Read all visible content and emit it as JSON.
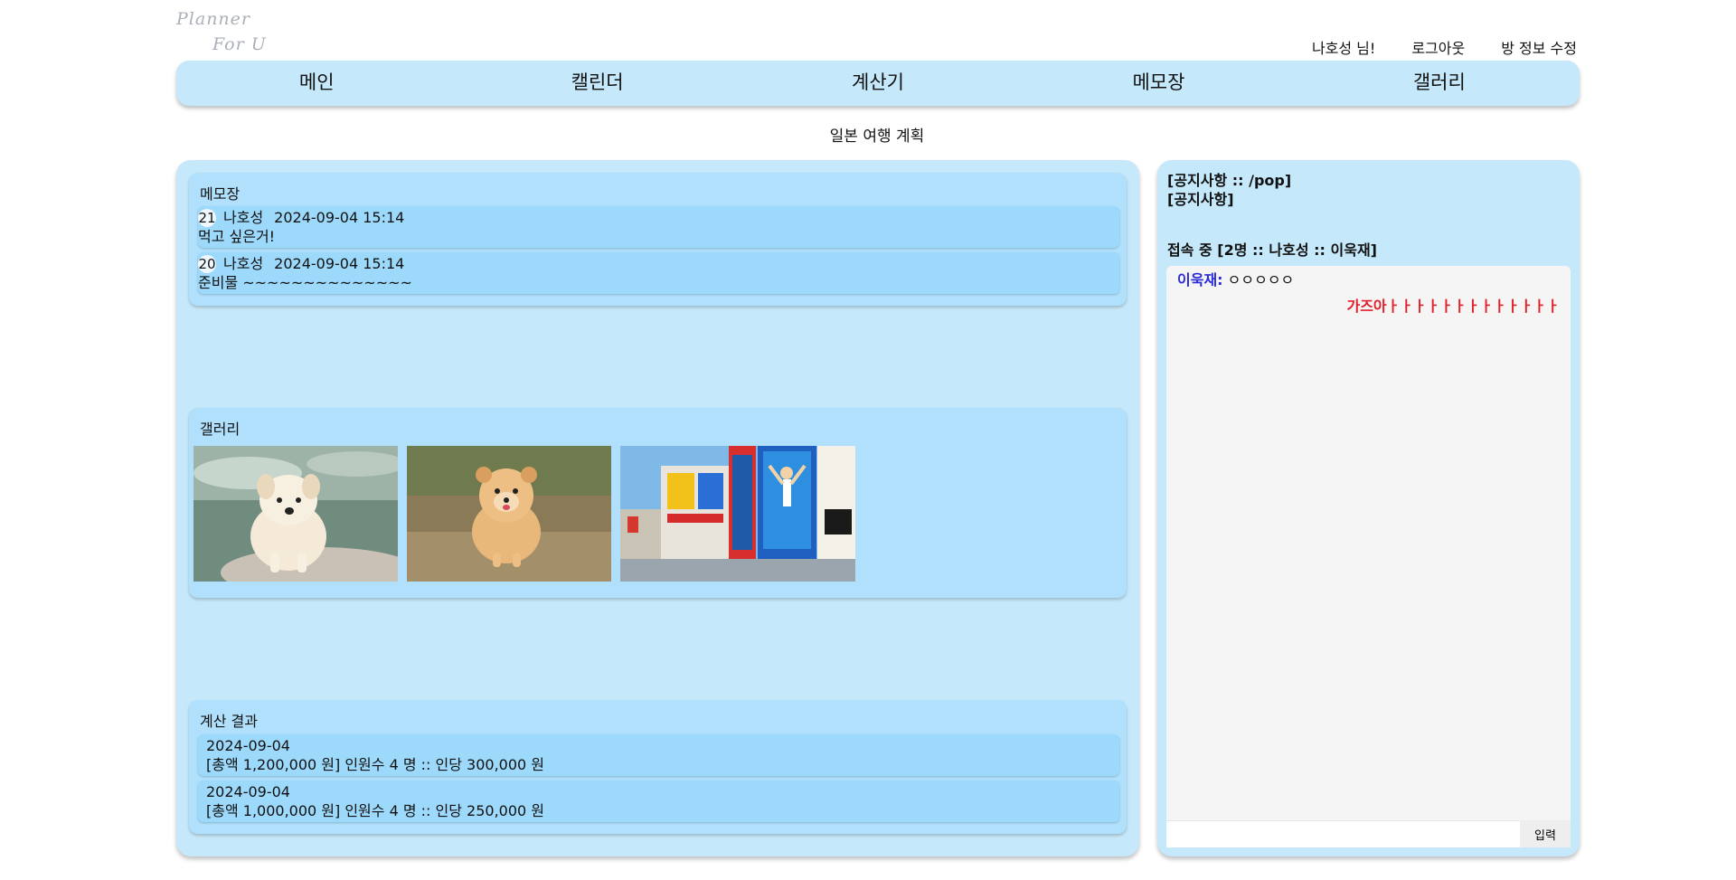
{
  "logo": {
    "line1": "Planner",
    "line2": "For U"
  },
  "topbar": {
    "user": "나호성 님!",
    "logout": "로그아웃",
    "edit_room": "방 정보 수정"
  },
  "nav": [
    "메인",
    "캘린더",
    "계산기",
    "메모장",
    "갤러리"
  ],
  "room_title": "일본 여행 계획",
  "memo": {
    "title": "메모장",
    "items": [
      {
        "id": "21",
        "author": "나호성",
        "datetime": "2024-09-04 15:14",
        "content": "먹고 싶은거!"
      },
      {
        "id": "20",
        "author": "나호성",
        "datetime": "2024-09-04 15:14",
        "content": "준비물 ~~~~~~~~~~~~~~"
      }
    ]
  },
  "gallery": {
    "title": "갤러리",
    "images": [
      "white-puppy-photo",
      "pomeranian-photo",
      "osaka-dotonbori-photo"
    ]
  },
  "calc": {
    "title": "계산 결과",
    "items": [
      {
        "date": "2024-09-04",
        "summary": "[총액 1,200,000 원] 인원수 4 명 :: 인당 300,000 원"
      },
      {
        "date": "2024-09-04",
        "summary": "[총액 1,000,000 원] 인원수 4 명 :: 인당 250,000 원"
      }
    ]
  },
  "sidebar": {
    "notice_title": "[공지사항 :: /pop]",
    "notice_body": "[공지사항]",
    "online": "접속 중 [2명 :: 나호성 :: 이욱재]"
  },
  "chat": {
    "messages": [
      {
        "who": "이욱재:",
        "text": "ㅇㅇㅇㅇㅇ"
      },
      {
        "text": "가즈아ㅏㅏㅏㅏㅏㅏㅏㅏㅏㅏㅏㅏㅏ"
      }
    ],
    "input_value": "",
    "send_label": "입력"
  },
  "colors": {
    "panel": "#c5e8fb",
    "card": "#b0e0fb",
    "row": "#9cd9fb",
    "chat_self": "#e0202a",
    "chat_other": "#2a2adb"
  }
}
